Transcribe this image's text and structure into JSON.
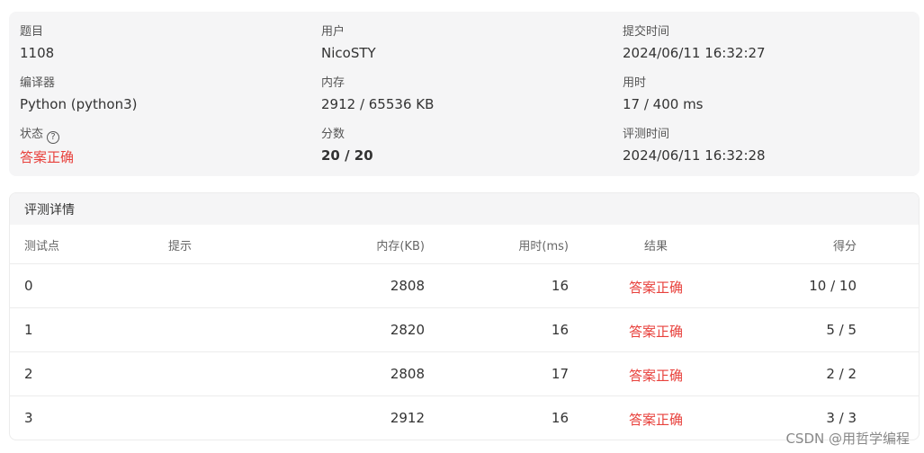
{
  "info": {
    "problem_label": "题目",
    "problem_value": "1108",
    "user_label": "用户",
    "user_value": "NicoSTY",
    "submit_time_label": "提交时间",
    "submit_time_value": "2024/06/11 16:32:27",
    "compiler_label": "编译器",
    "compiler_value": "Python (python3)",
    "memory_label": "内存",
    "memory_value": "2912 / 65536 KB",
    "time_label": "用时",
    "time_value": "17 / 400 ms",
    "status_label": "状态",
    "status_value": "答案正确",
    "score_label": "分数",
    "score_value": "20 / 20",
    "judge_time_label": "评测时间",
    "judge_time_value": "2024/06/11 16:32:28"
  },
  "details": {
    "title": "评测详情",
    "columns": {
      "case": "测试点",
      "hint": "提示",
      "memory": "内存(KB)",
      "time": "用时(ms)",
      "result": "结果",
      "score": "得分"
    },
    "rows": [
      {
        "case": "0",
        "hint": "",
        "memory": "2808",
        "time": "16",
        "result": "答案正确",
        "score": "10 / 10"
      },
      {
        "case": "1",
        "hint": "",
        "memory": "2820",
        "time": "16",
        "result": "答案正确",
        "score": "5 / 5"
      },
      {
        "case": "2",
        "hint": "",
        "memory": "2808",
        "time": "17",
        "result": "答案正确",
        "score": "2 / 2"
      },
      {
        "case": "3",
        "hint": "",
        "memory": "2912",
        "time": "16",
        "result": "答案正确",
        "score": "3 / 3"
      }
    ]
  },
  "watermark": "CSDN @用哲学编程",
  "colors": {
    "accepted": "#e8413c",
    "card_bg": "#f5f5f6",
    "border": "#ececec"
  },
  "icons": {
    "status_help": "question-circle-icon"
  }
}
